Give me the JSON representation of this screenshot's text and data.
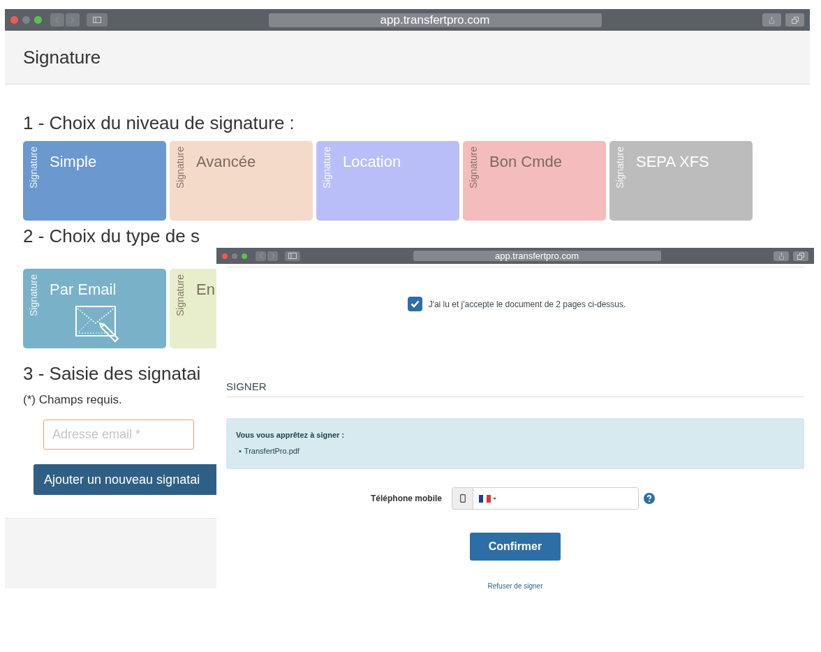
{
  "back_window": {
    "url": "app.transfertpro.com",
    "header_title": "Signature",
    "level_heading": "1 - Choix du niveau de signature :",
    "level_cards": [
      {
        "tag": "Signature",
        "label": "Simple",
        "color": "#6a98cf"
      },
      {
        "tag": "Signature",
        "label": "Avancée",
        "color": "#f4dac9"
      },
      {
        "tag": "Signature",
        "label": "Location",
        "color": "#b9bef8"
      },
      {
        "tag": "Signature",
        "label": "Bon Cmde",
        "color": "#f4bcbd"
      },
      {
        "tag": "Signature",
        "label": "SEPA XFS",
        "color": "#bbbcbb"
      }
    ],
    "type_heading": "2 - Choix du type de s",
    "type_cards": [
      {
        "tag": "Signature",
        "label": "Par Email",
        "color": "#79b2c8",
        "kind": "email"
      },
      {
        "tag": "Signature",
        "label": "En",
        "color": "#e8eecc",
        "kind": "plain"
      }
    ],
    "signers_heading": "3 - Saisie des signatai",
    "required_note": "(*) Champs requis.",
    "email_field": {
      "placeholder": "Adresse email *"
    },
    "add_button": "Ajouter un nouveau signatai"
  },
  "front_window": {
    "url": "app.transfertpro.com",
    "accept": {
      "checked": true,
      "label": "J'ai lu et j'accepte le document de 2 pages ci-dessus."
    },
    "sign_heading": "SIGNER",
    "notice": {
      "title": "Vous vous apprêtez à signer :",
      "files": [
        {
          "bullet": "•",
          "name": "TransfertPro.pdf"
        }
      ]
    },
    "phone": {
      "label": "Téléphone mobile"
    },
    "confirm_button": "Confirmer",
    "refuse_link": "Refuser de signer"
  }
}
